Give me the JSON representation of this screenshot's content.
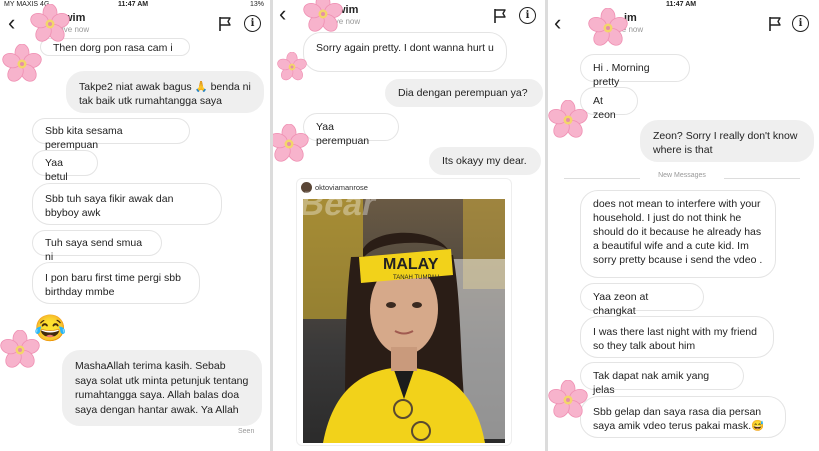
{
  "colors": {
    "bubble_me": "#efefef",
    "bubble_them": "#ffffff",
    "border": "#e4e4e4",
    "yellow": "#f2d21a"
  },
  "panels": [
    {
      "status_left": "MY MAXIS  4G",
      "status_time": "11:47 AM",
      "status_right": "13%",
      "header_name": "wim",
      "header_sub": "ive now",
      "messages": [
        "Then dorg pon rasa cam i",
        "Takpe2 niat awak bagus 🙏 benda ni tak baik utk rumahtangga saya",
        "Sbb kita sesama perempuan",
        "Yaa betul",
        "Sbb tuh saya fikir awak dan bbyboy awk",
        "Tuh saya send smua ni",
        "I pon baru first time pergi sbb birthday mmbe",
        "😂",
        "MashaAllah terima kasih. Sebab saya solat utk minta petunjuk tentang rumahtangga saya. Allah balas doa saya dengan hantar awak. Ya Allah"
      ],
      "seen": "Seen"
    },
    {
      "header_name": "wim",
      "header_sub": "ive now",
      "messages": [
        "Sorry again pretty. I dont wanna hurt u",
        "Dia dengan perempuan ya?",
        "Yaa perempuan",
        "Its okayy my dear."
      ],
      "photo_user": "oktoviamanrose",
      "headband_text": "MALAY",
      "headband_sub": "TANAH TUMPAH",
      "watermark": "Bear"
    },
    {
      "header_name": "im",
      "header_sub": "ive now",
      "status_time": "11:47 AM",
      "messages": [
        "Hi . Morning pretty",
        "At zeon",
        "Zeon? Sorry I really don't know where is that",
        "does not mean to interfere with your household. I just do not think he should do it because he already has a beautiful wife and a cute kid. Im sorry pretty bcause i send the vdeo .",
        "Yaa zeon at changkat",
        "I was there last night with my friend so they talk about him",
        "Tak dapat nak amik yang jelas",
        "Sbb gelap dan saya rasa dia persan saya amik vdeo terus pakai mask.😅"
      ],
      "divider": "New Messages"
    }
  ]
}
